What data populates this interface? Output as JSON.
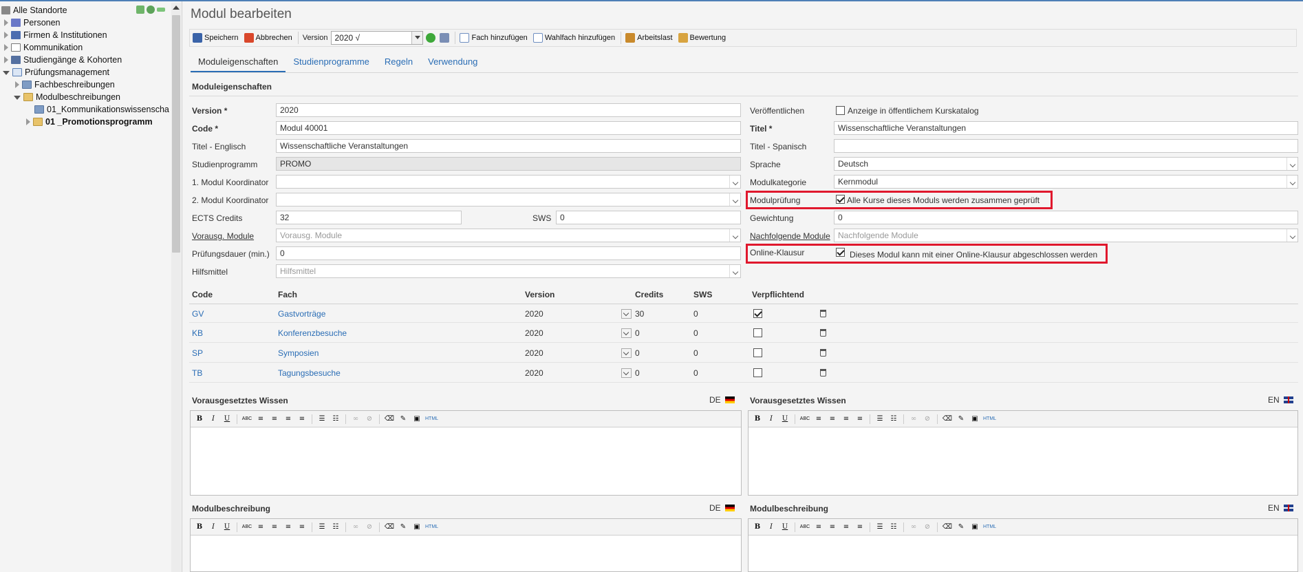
{
  "sidebar": {
    "items": [
      {
        "label": "Alle Standorte",
        "icon": "building-icon"
      },
      {
        "label": "Personen",
        "icon": "people-icon"
      },
      {
        "label": "Firmen & Institutionen",
        "icon": "company-icon"
      },
      {
        "label": "Kommunikation",
        "icon": "mail-icon"
      },
      {
        "label": "Studiengänge & Kohorten",
        "icon": "graduation-icon"
      },
      {
        "label": "Prüfungsmanagement",
        "icon": "exam-icon"
      },
      {
        "label": "Fachbeschreibungen",
        "icon": "folder-icon"
      },
      {
        "label": "Modulbeschreibungen",
        "icon": "folder-open-icon"
      },
      {
        "label": "01_Kommunikationswissenscha",
        "icon": "folder-blue-icon"
      },
      {
        "label": "01 _Promotionsprogramm",
        "icon": "folder-icon"
      }
    ]
  },
  "header": {
    "title": "Modul bearbeiten"
  },
  "toolbar": {
    "save": "Speichern",
    "cancel": "Abbrechen",
    "version_label": "Version",
    "version_value": "2020 √",
    "add_subject": "Fach hinzufügen",
    "add_elective": "Wahlfach hinzufügen",
    "workload": "Arbeitslast",
    "rating": "Bewertung"
  },
  "tabs": [
    "Moduleigenschaften",
    "Studienprogramme",
    "Regeln",
    "Verwendung"
  ],
  "form": {
    "section_title": "Moduleigenschaften",
    "left": {
      "version_label": "Version *",
      "version_value": "2020",
      "code_label": "Code *",
      "code_value": "Modul 40001",
      "title_en_label": "Titel - Englisch",
      "title_en_value": "Wissenschaftliche Veranstaltungen",
      "program_label": "Studienprogramm",
      "program_value": "PROMO",
      "coord1_label": "1. Modul Koordinator",
      "coord1_value": "",
      "coord2_label": "2. Modul Koordinator",
      "coord2_value": "",
      "ects_label": "ECTS Credits",
      "ects_value": "32",
      "sws_label": "SWS",
      "sws_value": "0",
      "prereq_label": "Vorausg. Module",
      "prereq_placeholder": "Vorausg. Module",
      "duration_label": "Prüfungsdauer (min.)",
      "duration_value": "0",
      "aids_label": "Hilfsmittel",
      "aids_placeholder": "Hilfsmittel"
    },
    "right": {
      "publish_label": "Veröffentlichen",
      "publish_text": "Anzeige in öffentlichem Kurskatalog",
      "title_label": "Titel *",
      "title_value": "Wissenschaftliche Veranstaltungen",
      "title_es_label": "Titel - Spanisch",
      "title_es_value": "",
      "lang_label": "Sprache",
      "lang_value": "Deutsch",
      "category_label": "Modulkategorie",
      "category_value": "Kernmodul",
      "exam_label": "Modulprüfung",
      "exam_text": "Alle Kurse dieses Moduls werden zusammen geprüft",
      "weight_label": "Gewichtung",
      "weight_value": "0",
      "next_label": "Nachfolgende Module",
      "next_placeholder": "Nachfolgende Module",
      "online_label": "Online-Klausur",
      "online_text": "Dieses Modul kann mit einer Online-Klausur abgeschlossen werden"
    }
  },
  "subjects": {
    "headers": [
      "Code",
      "Fach",
      "Version",
      "Credits",
      "SWS",
      "Verpflichtend"
    ],
    "rows": [
      {
        "code": "GV",
        "name": "Gastvorträge",
        "version": "2020",
        "credits": "30",
        "sws": "0",
        "required": true
      },
      {
        "code": "KB",
        "name": "Konferenzbesuche",
        "version": "2020",
        "credits": "0",
        "sws": "0",
        "required": false
      },
      {
        "code": "SP",
        "name": "Symposien",
        "version": "2020",
        "credits": "0",
        "sws": "0",
        "required": false
      },
      {
        "code": "TB",
        "name": "Tagungsbesuche",
        "version": "2020",
        "credits": "0",
        "sws": "0",
        "required": false
      }
    ]
  },
  "editors": {
    "prior_knowledge": "Vorausgesetztes Wissen",
    "description": "Modulbeschreibung",
    "lang_de": "DE",
    "lang_en": "EN",
    "buttons": [
      "B",
      "I",
      "U",
      "ABC",
      "HTML"
    ]
  }
}
